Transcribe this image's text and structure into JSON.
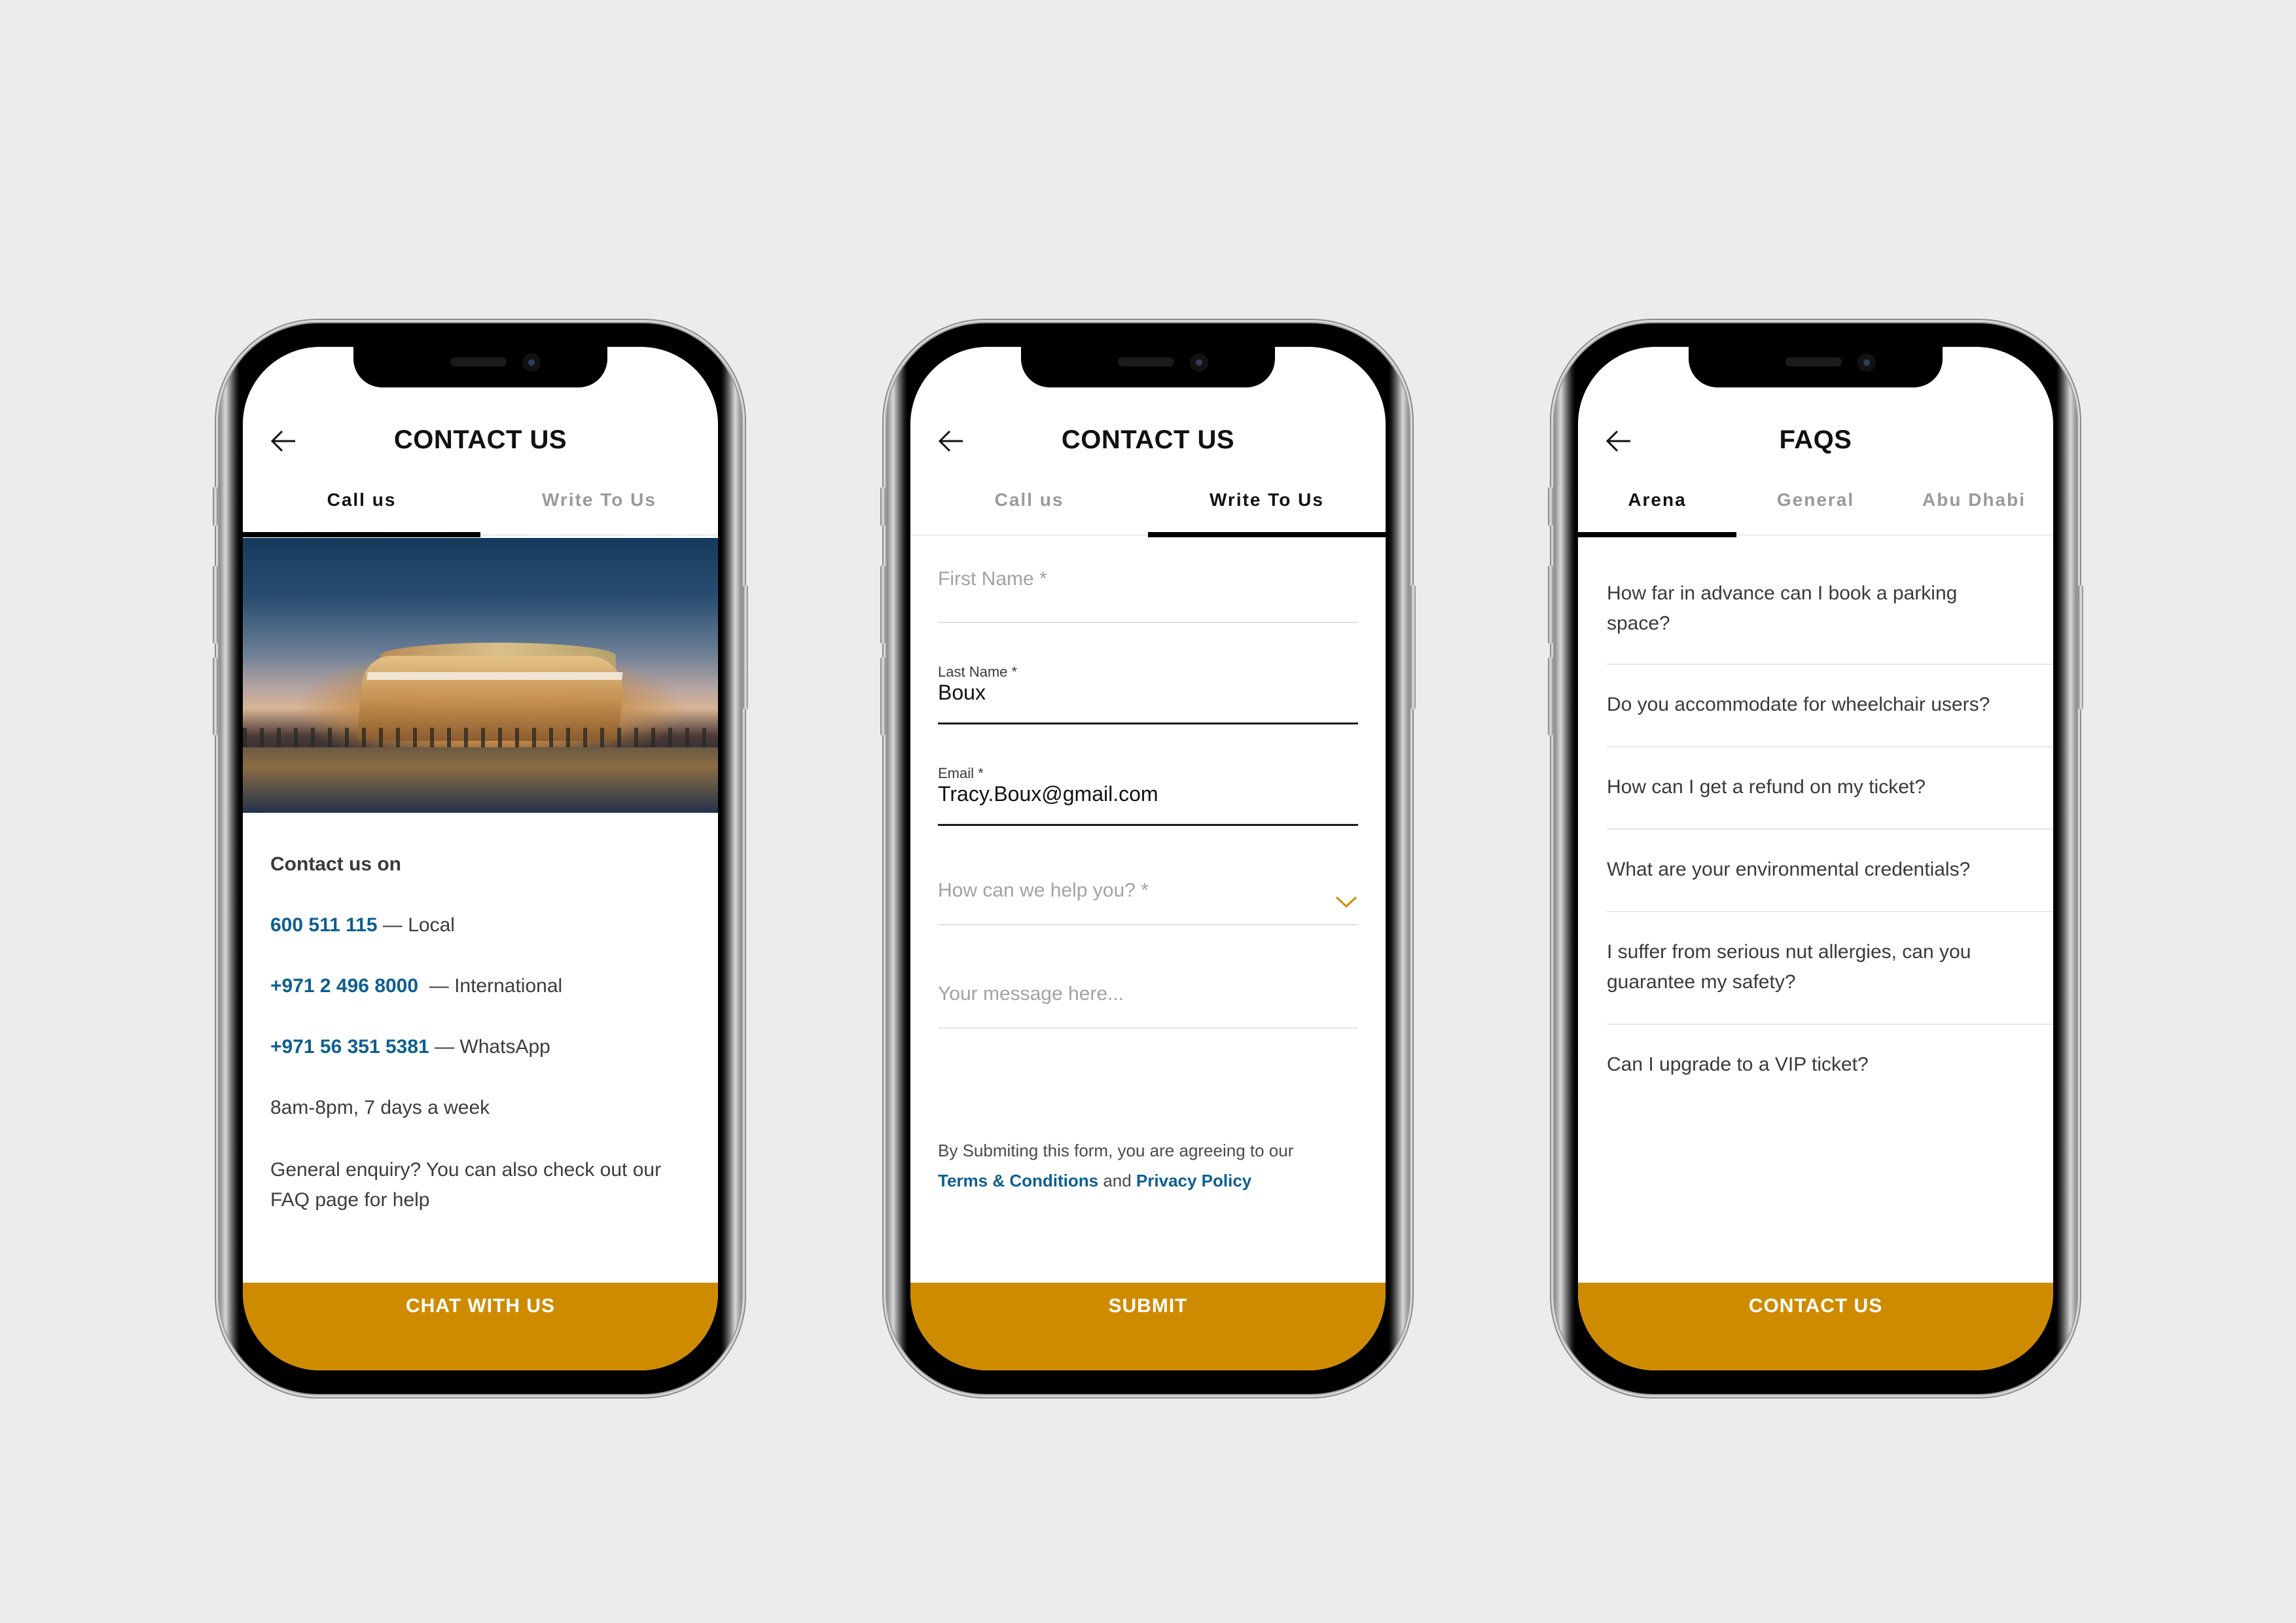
{
  "colors": {
    "accent": "#cf8b00",
    "link": "#0d5f91",
    "background": "#ececec"
  },
  "screens": [
    {
      "title": "CONTACT US",
      "back_icon": "arrow-left-icon",
      "tabs": [
        {
          "label": "Call us",
          "active": true
        },
        {
          "label": "Write To Us",
          "active": false
        }
      ],
      "hero_image": "arena-night-rendering",
      "heading": "Contact us on",
      "contacts": [
        {
          "number": "600 511 115",
          "suffix": " — Local"
        },
        {
          "number": "+971 2 496 8000",
          "suffix": "  — International"
        },
        {
          "number": "+971 56 351 5381",
          "suffix": " — WhatsApp"
        }
      ],
      "hours": "8am-8pm, 7 days a week",
      "note": "General enquiry? You can also check out our FAQ page for help",
      "cta": "CHAT WITH US"
    },
    {
      "title": "CONTACT US",
      "back_icon": "arrow-left-icon",
      "tabs": [
        {
          "label": "Call us",
          "active": false
        },
        {
          "label": "Write To Us",
          "active": true
        }
      ],
      "form": {
        "first_name": {
          "placeholder": "First Name *",
          "value": ""
        },
        "last_name": {
          "label": "Last Name *",
          "value": "Boux"
        },
        "email": {
          "label": "Email *",
          "value": "Tracy.Boux@gmail.com"
        },
        "help_select": {
          "placeholder": "How can we help you? *",
          "icon": "chevron-down-icon"
        },
        "message": {
          "placeholder": "Your message here..."
        }
      },
      "legal": {
        "prefix": "By Submiting this form, you are agreeing to our",
        "terms": "Terms & Conditions",
        "and": " and ",
        "privacy": "Privacy Policy"
      },
      "cta": "SUBMIT"
    },
    {
      "title": "FAQS",
      "back_icon": "arrow-left-icon",
      "tabs": [
        {
          "label": "Arena",
          "active": true
        },
        {
          "label": "General",
          "active": false
        },
        {
          "label": "Abu Dhabi",
          "active": false
        }
      ],
      "faqs": [
        "How far in advance can I book a parking space?",
        "Do you accommodate for wheelchair users?",
        "How can I get a refund on my ticket?",
        "What are your environmental credentials?",
        "I suffer from serious nut allergies, can you guarantee my safety?",
        "Can I upgrade to a VIP ticket?"
      ],
      "cta": "CONTACT US"
    }
  ]
}
